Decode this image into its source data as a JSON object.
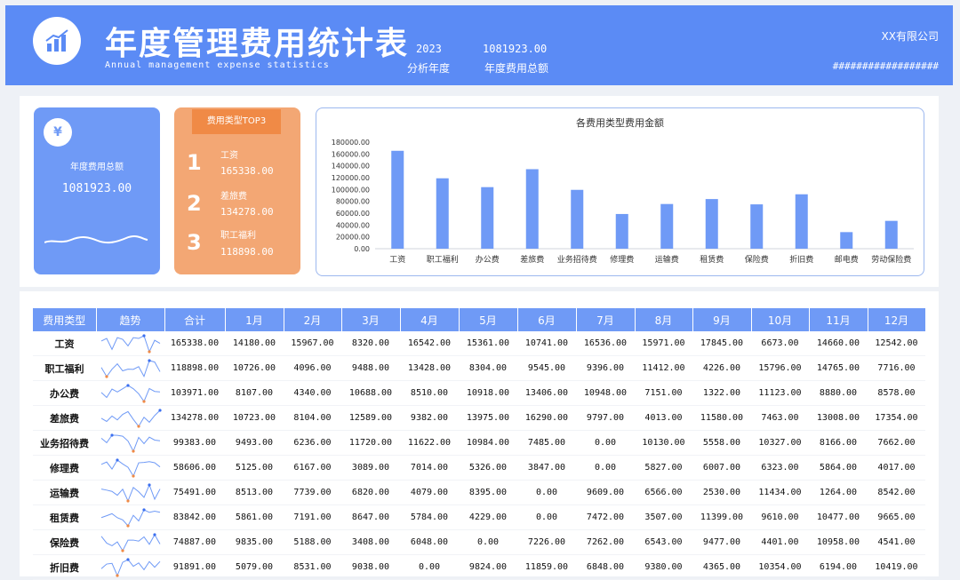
{
  "header": {
    "title": "年度管理费用统计表",
    "subtitle": "Annual management expense statistics",
    "year_value": "2023",
    "year_label": "分析年度",
    "total_value": "1081923.00",
    "total_label": "年度费用总额",
    "company": "XX有限公司",
    "hash_text": "##################"
  },
  "summary_card": {
    "icon": "receipt-icon",
    "label": "年度费用总额",
    "value": "1081923.00"
  },
  "top3": {
    "title": "费用类型TOP3",
    "items": [
      {
        "rank": "1",
        "name": "工资",
        "value": "165338.00"
      },
      {
        "rank": "2",
        "name": "差旅费",
        "value": "134278.00"
      },
      {
        "rank": "3",
        "name": "职工福利",
        "value": "118898.00"
      }
    ]
  },
  "chart_data": {
    "type": "bar",
    "title": "各费用类型费用金额",
    "categories": [
      "工资",
      "职工福利",
      "办公费",
      "差旅费",
      "业务招待费",
      "修理费",
      "运输费",
      "租赁费",
      "保险费",
      "折旧费",
      "邮电费",
      "劳动保险费"
    ],
    "values": [
      165338,
      118898,
      103971,
      134278,
      99383,
      58606,
      75491,
      83842,
      74887,
      91891,
      28000,
      47000
    ],
    "ylim": [
      0,
      180000
    ],
    "yticks": [
      "0.00",
      "20000.00",
      "40000.00",
      "60000.00",
      "80000.00",
      "100000.00",
      "120000.00",
      "140000.00",
      "160000.00",
      "180000.00"
    ],
    "color": "#6f9af6",
    "grid": false
  },
  "table": {
    "headers": [
      "费用类型",
      "趋势",
      "合计",
      "1月",
      "2月",
      "3月",
      "4月",
      "5月",
      "6月",
      "7月",
      "8月",
      "9月",
      "10月",
      "11月",
      "12月"
    ],
    "rows": [
      {
        "type": "工资",
        "total": "165338.00",
        "months": [
          "14180.00",
          "15967.00",
          "8320.00",
          "16542.00",
          "15361.00",
          "10741.00",
          "16536.00",
          "15971.00",
          "17845.00",
          "6673.00",
          "14660.00",
          "12542.00"
        ],
        "trend": [
          14180,
          15967,
          8320,
          16542,
          15361,
          10741,
          16536,
          15971,
          17845,
          6673,
          14660,
          12542
        ]
      },
      {
        "type": "职工福利",
        "total": "118898.00",
        "months": [
          "10726.00",
          "4096.00",
          "9488.00",
          "13428.00",
          "8304.00",
          "9545.00",
          "9396.00",
          "11412.00",
          "4226.00",
          "15796.00",
          "14765.00",
          "7716.00"
        ],
        "trend": [
          10726,
          4096,
          9488,
          13428,
          8304,
          9545,
          9396,
          11412,
          4226,
          15796,
          14765,
          7716
        ]
      },
      {
        "type": "办公费",
        "total": "103971.00",
        "months": [
          "8107.00",
          "4340.00",
          "10688.00",
          "8510.00",
          "10918.00",
          "13406.00",
          "10948.00",
          "7151.00",
          "1322.00",
          "11123.00",
          "8880.00",
          "8578.00"
        ],
        "trend": [
          8107,
          4340,
          10688,
          8510,
          10918,
          13406,
          10948,
          7151,
          1322,
          11123,
          8880,
          8578
        ]
      },
      {
        "type": "差旅费",
        "total": "134278.00",
        "months": [
          "10723.00",
          "8104.00",
          "12589.00",
          "9382.00",
          "13975.00",
          "16290.00",
          "9797.00",
          "4013.00",
          "11580.00",
          "7463.00",
          "13008.00",
          "17354.00"
        ],
        "trend": [
          10723,
          8104,
          12589,
          9382,
          13975,
          16290,
          9797,
          4013,
          11580,
          7463,
          13008,
          17354
        ]
      },
      {
        "type": "业务招待费",
        "total": "99383.00",
        "months": [
          "9493.00",
          "6236.00",
          "11720.00",
          "11622.00",
          "10984.00",
          "7485.00",
          "0.00",
          "10130.00",
          "5558.00",
          "10327.00",
          "8166.00",
          "7662.00"
        ],
        "trend": [
          9493,
          6236,
          11720,
          11622,
          10984,
          7485,
          0,
          10130,
          5558,
          10327,
          8166,
          7662
        ]
      },
      {
        "type": "修理费",
        "total": "58606.00",
        "months": [
          "5125.00",
          "6167.00",
          "3089.00",
          "7014.00",
          "5326.00",
          "3847.00",
          "0.00",
          "5827.00",
          "6007.00",
          "6323.00",
          "5864.00",
          "4017.00"
        ],
        "trend": [
          5125,
          6167,
          3089,
          7014,
          5326,
          3847,
          0,
          5827,
          6007,
          6323,
          5864,
          4017
        ]
      },
      {
        "type": "运输费",
        "total": "75491.00",
        "months": [
          "8513.00",
          "7739.00",
          "6820.00",
          "4079.00",
          "8395.00",
          "0.00",
          "9609.00",
          "6566.00",
          "2530.00",
          "11434.00",
          "1264.00",
          "8542.00"
        ],
        "trend": [
          8513,
          7739,
          6820,
          4079,
          8395,
          0,
          9609,
          6566,
          2530,
          11434,
          1264,
          8542
        ]
      },
      {
        "type": "租赁费",
        "total": "83842.00",
        "months": [
          "5861.00",
          "7191.00",
          "8647.00",
          "5784.00",
          "4229.00",
          "0.00",
          "7472.00",
          "3507.00",
          "11399.00",
          "9610.00",
          "10477.00",
          "9665.00"
        ],
        "trend": [
          5861,
          7191,
          8647,
          5784,
          4229,
          0,
          7472,
          3507,
          11399,
          9610,
          10477,
          9665
        ]
      },
      {
        "type": "保险费",
        "total": "74887.00",
        "months": [
          "9835.00",
          "5188.00",
          "3408.00",
          "6048.00",
          "0.00",
          "7226.00",
          "7262.00",
          "6543.00",
          "9477.00",
          "4401.00",
          "10958.00",
          "4541.00"
        ],
        "trend": [
          9835,
          5188,
          3408,
          6048,
          0,
          7226,
          7262,
          6543,
          9477,
          4401,
          10958,
          4541
        ]
      },
      {
        "type": "折旧费",
        "total": "91891.00",
        "months": [
          "5079.00",
          "8531.00",
          "9038.00",
          "0.00",
          "9824.00",
          "11859.00",
          "6848.00",
          "9380.00",
          "4365.00",
          "10354.00",
          "6194.00",
          "10419.00"
        ],
        "trend": [
          5079,
          8531,
          9038,
          0,
          9824,
          11859,
          6848,
          9380,
          4365,
          10354,
          6194,
          10419
        ]
      }
    ]
  }
}
